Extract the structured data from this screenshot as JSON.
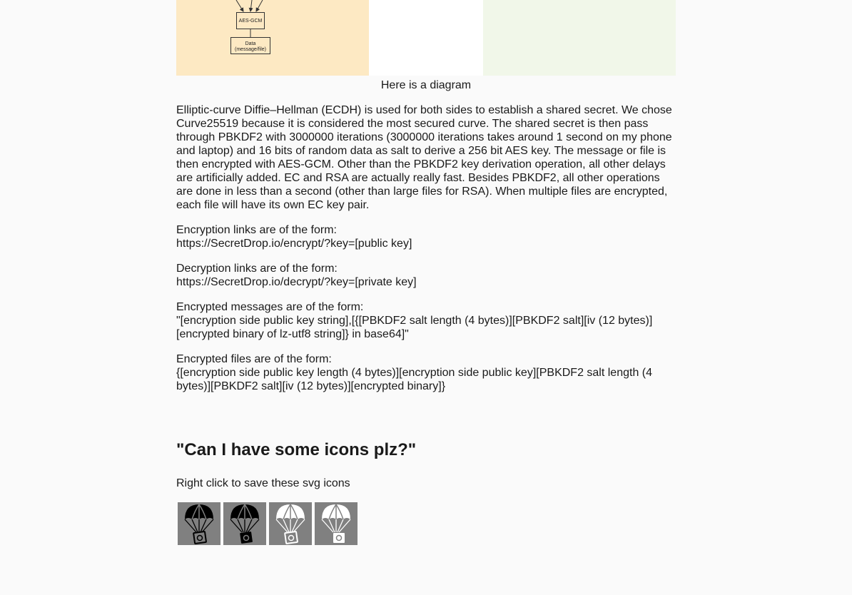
{
  "diagram": {
    "box_aes": "AES-GCM",
    "box_data_line1": "Data",
    "box_data_line2": "(message/file)",
    "caption": "Here is a diagram"
  },
  "paragraphs": {
    "ecdh": "Elliptic-curve Diffie–Hellman (ECDH) is used for both sides to establish a shared secret. We chose Curve25519 because it is considered the most secured curve. The shared secret is then pass through PBKDF2 with 3000000 iterations (3000000 iterations takes around 1 second on my phone and laptop) and 16 bits of random data as salt to derive a 256 bit AES key. The message or file is then encrypted with AES-GCM. Other than the PBKDF2 key derivation operation, all other delays are artificially added. EC and RSA are actually really fast. Besides PBKDF2, all other operations are done in less than a second (other than large files for RSA). When multiple files are encrypted, each file will have its own EC key pair.",
    "encryption_links": "Encryption links are of the form:\nhttps://SecretDrop.io/encrypt/?key=[public key]",
    "decryption_links": "Decryption links are of the form:\nhttps://SecretDrop.io/decrypt/?key=[private key]",
    "encrypted_messages": "Encrypted messages are of the form:\n\"[encryption side public key string],[{[PBKDF2 salt length (4 bytes)][PBKDF2 salt][iv (12 bytes)][encrypted binary of lz-utf8 string]} in base64]\"",
    "encrypted_files": "Encrypted files are of the form:\n{[encryption side public key length (4 bytes)][encryption side public key][PBKDF2 salt length (4 bytes)][PBKDF2 salt][iv (12 bytes)][encrypted binary]}"
  },
  "icons_section": {
    "heading": "\"Can I have some icons plz?\"",
    "hint": "Right click to save these svg icons",
    "icons": [
      "parachute-lock-icon-black",
      "parachute-lock-icon-black-filled",
      "parachute-lock-icon-white",
      "parachute-lock-icon-white-filled"
    ],
    "tile_color": "#808080"
  },
  "colors": {
    "panel_left": "#fde9c3",
    "panel_mid": "#ffffff",
    "panel_right": "#f1f7e9",
    "background": "#fafafa"
  }
}
